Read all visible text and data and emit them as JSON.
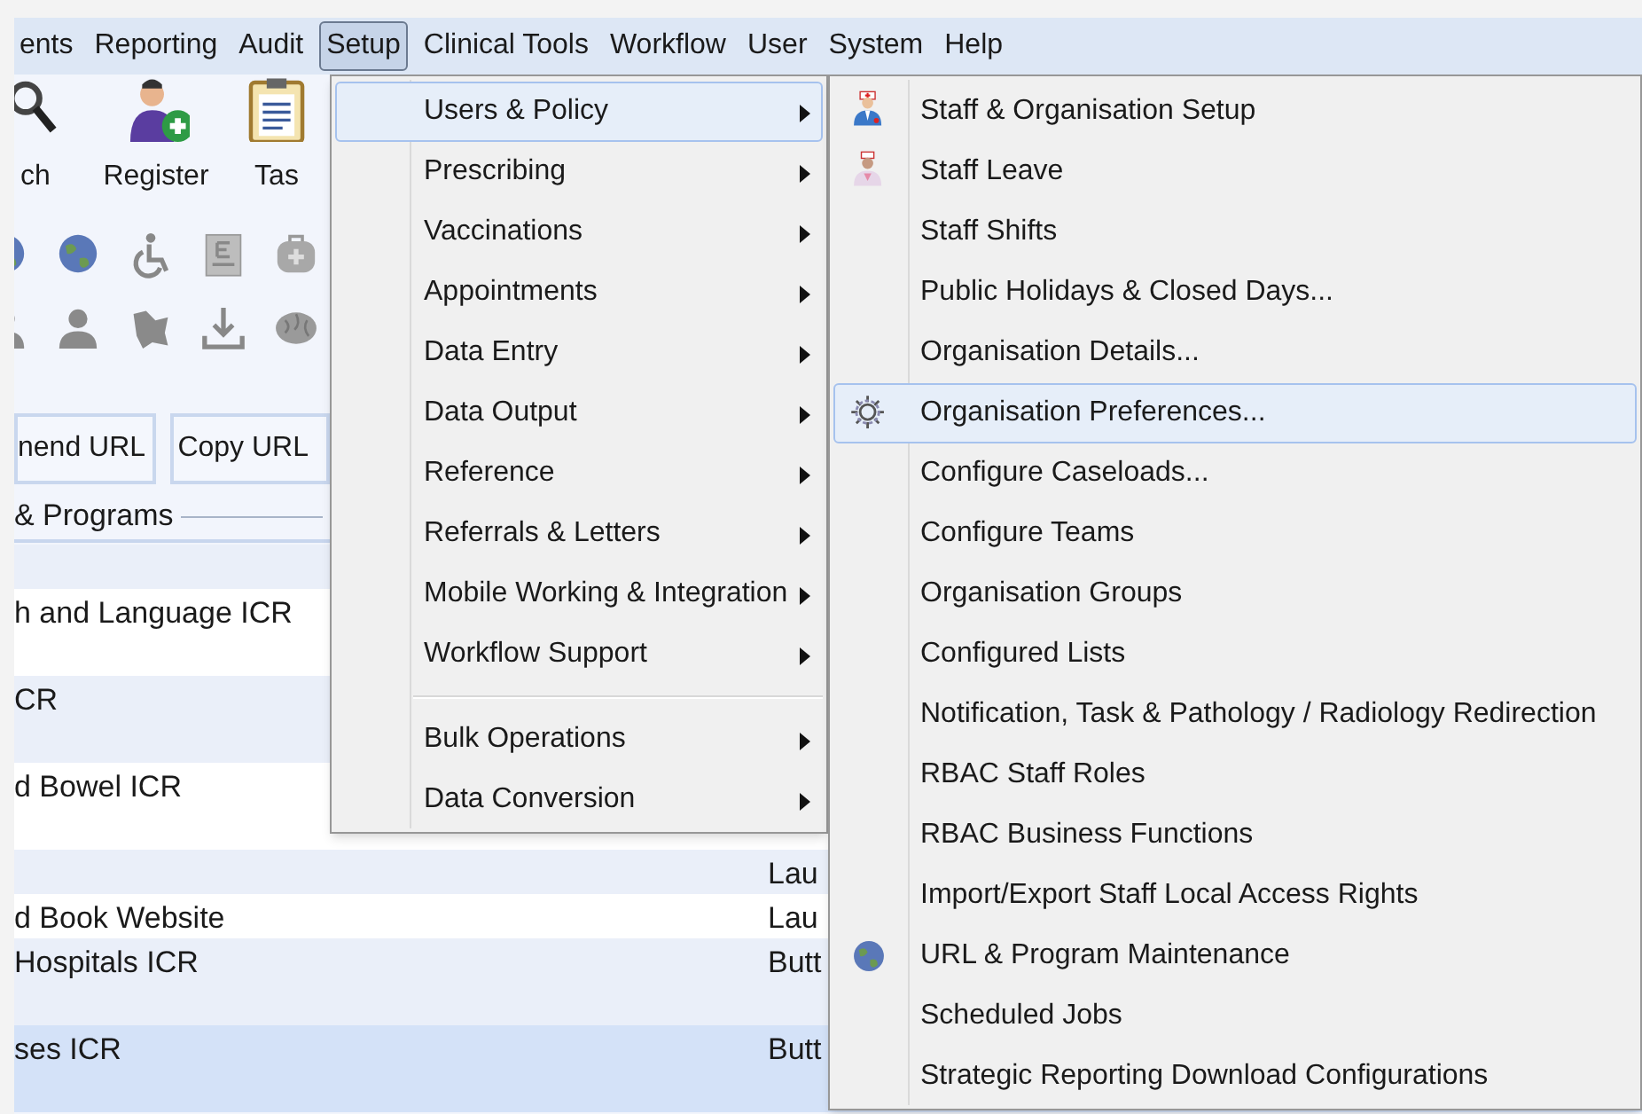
{
  "menu_bar": [
    {
      "label": "ents",
      "selected": false
    },
    {
      "label": "Reporting",
      "selected": false
    },
    {
      "label": "Audit",
      "selected": false
    },
    {
      "label": "Setup",
      "selected": true
    },
    {
      "label": "Clinical Tools",
      "selected": false
    },
    {
      "label": "Workflow",
      "selected": false
    },
    {
      "label": "User",
      "selected": false
    },
    {
      "label": "System",
      "selected": false
    },
    {
      "label": "Help",
      "selected": false
    }
  ],
  "toolbar": [
    {
      "label": "ch"
    },
    {
      "label": "Register"
    },
    {
      "label": "Tas"
    }
  ],
  "url_buttons": [
    "nend URL",
    "Copy URL"
  ],
  "group_title": "& Programs",
  "table_rows": [
    {
      "selected": false
    },
    {
      "column_1": "h and Language ICR",
      "selected": false
    },
    {
      "column_1": "CR",
      "selected": false
    },
    {
      "column_1": "d Bowel ICR",
      "selected": false
    },
    {
      "column_2": "Lau",
      "selected": false
    },
    {
      "column_1": "d Book Website",
      "column_2": "Lau",
      "selected": false
    },
    {
      "column_1": "Hospitals ICR",
      "column_2": "Butt",
      "selected": false
    },
    {
      "column_1": "ses ICR",
      "column_2": "Butt",
      "selected": true
    }
  ],
  "setup_menu": [
    {
      "label": "Users & Policy",
      "selected": true
    },
    {
      "label": "Prescribing",
      "selected": false
    },
    {
      "label": "Vaccinations",
      "selected": false
    },
    {
      "label": "Appointments",
      "selected": false
    },
    {
      "label": "Data Entry",
      "selected": false
    },
    {
      "label": "Data Output",
      "selected": false
    },
    {
      "label": "Reference",
      "selected": false
    },
    {
      "label": "Referrals & Letters",
      "selected": false
    },
    {
      "label": "Mobile Working & Integration",
      "selected": false
    },
    {
      "label": "Workflow Support",
      "selected": false
    },
    {
      "kind": "separator"
    },
    {
      "label": "Bulk Operations",
      "selected": false
    },
    {
      "label": "Data Conversion",
      "selected": false
    }
  ],
  "users_policy_submenu": [
    {
      "label": "Staff & Organisation Setup",
      "selected": false
    },
    {
      "label": "Staff Leave",
      "selected": false
    },
    {
      "label": "Staff Shifts",
      "selected": false
    },
    {
      "label": "Public Holidays & Closed Days...",
      "selected": false
    },
    {
      "label": "Organisation Details...",
      "selected": false
    },
    {
      "label": "Organisation Preferences...",
      "selected": true
    },
    {
      "label": "Configure Caseloads...",
      "selected": false
    },
    {
      "label": "Configure Teams",
      "selected": false
    },
    {
      "label": "Organisation Groups",
      "selected": false
    },
    {
      "label": "Configured Lists",
      "selected": false
    },
    {
      "label": "Notification, Task & Pathology / Radiology Redirection",
      "selected": false
    },
    {
      "label": "RBAC Staff Roles",
      "selected": false
    },
    {
      "label": "RBAC Business Functions",
      "selected": false
    },
    {
      "label": "Import/Export Staff Local Access Rights",
      "selected": false
    },
    {
      "label": "URL & Program Maintenance",
      "selected": false
    },
    {
      "label": "Scheduled Jobs",
      "selected": false
    },
    {
      "label": "Strategic Reporting Download Configurations",
      "selected": false
    }
  ]
}
